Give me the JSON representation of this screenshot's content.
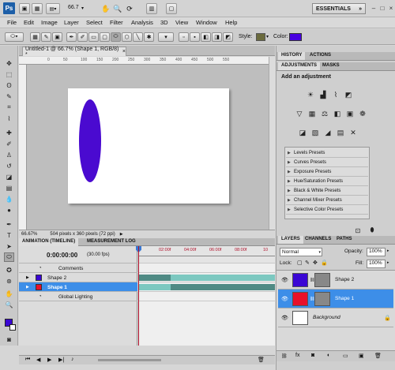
{
  "app": {
    "logo": "Ps",
    "zoom": "66.7",
    "workspace": "ESSENTIALS",
    "window_controls": [
      "–",
      "□",
      "×"
    ]
  },
  "menu": [
    "File",
    "Edit",
    "Image",
    "Layer",
    "Select",
    "Filter",
    "Analysis",
    "3D",
    "View",
    "Window",
    "Help"
  ],
  "options": {
    "style_label": "Style:",
    "color_label": "Color:",
    "color": "#4800e0"
  },
  "document": {
    "tab_title": "Untitled-1 @ 66.7% (Shape 1, RGB/8) *",
    "zoom_status": "66.67%",
    "info_status": "504 pixels x 360 pixels (72 ppi)",
    "ruler_ticks": [
      "0",
      "50",
      "100",
      "150",
      "200",
      "250",
      "300",
      "350",
      "400",
      "450",
      "500",
      "550"
    ],
    "shape_color": "#4a0ad0"
  },
  "animation": {
    "tabs": [
      "ANIMATION (TIMELINE)",
      "MEASUREMENT LOG"
    ],
    "time": "0:00:00:00",
    "fps": "(30.00 fps)",
    "time_ticks": [
      "02:00f",
      "04:00f",
      "06:00f",
      "08:00f",
      "10"
    ],
    "rows": {
      "comments": "Comments",
      "shape2": "Shape 2",
      "shape1": "Shape 1",
      "lighting": "Global Lighting"
    }
  },
  "panels": {
    "history_tabs": [
      "HISTORY",
      "ACTIONS"
    ],
    "adjust_tabs": [
      "ADJUSTMENTS",
      "MASKS"
    ],
    "adjust_heading": "Add an adjustment",
    "presets": [
      "Levels Presets",
      "Curves Presets",
      "Exposure Presets",
      "Hue/Saturation Presets",
      "Black & White Presets",
      "Channel Mixer Presets",
      "Selective Color Presets"
    ],
    "layers_tabs": [
      "LAYERS",
      "CHANNELS",
      "PATHS"
    ],
    "blend_mode": "Normal",
    "opacity_label": "Opacity:",
    "opacity": "100%",
    "lock_label": "Lock:",
    "fill_label": "Fill:",
    "fill": "100%",
    "layers": [
      {
        "name": "Shape 2",
        "color": "#3a07d4"
      },
      {
        "name": "Shape 1",
        "color": "#e8102a"
      },
      {
        "name": "Background",
        "color": "#ffffff"
      }
    ]
  },
  "colors": {
    "selection_blue": "#3d8ee8",
    "timeline_bar": "#7cc8c0"
  }
}
